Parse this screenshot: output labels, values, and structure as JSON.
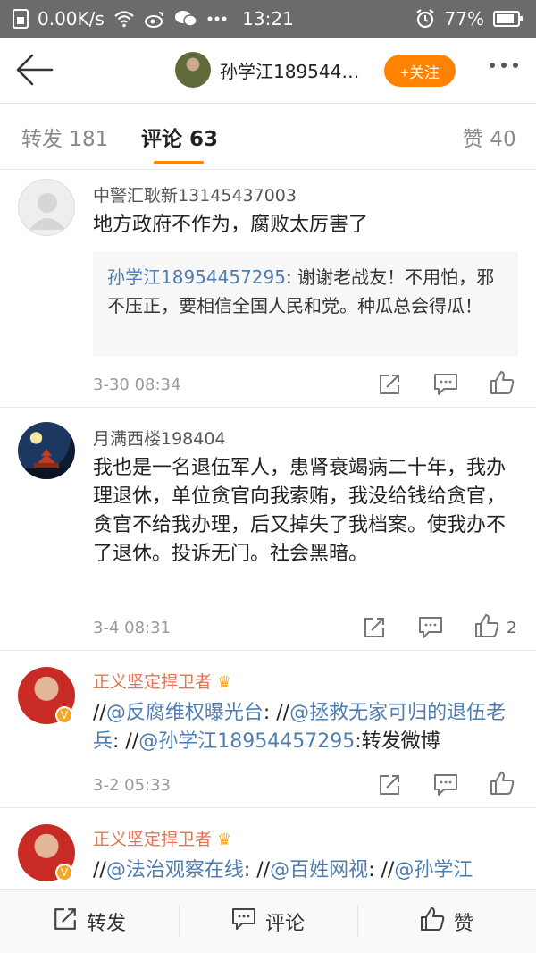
{
  "status": {
    "speed": "0.00K/s",
    "time": "13:21",
    "battery": "77%",
    "icons": [
      "sim-icon",
      "wifi-icon",
      "weibo-icon",
      "wechat-icon",
      "dots-icon",
      "alarm-icon",
      "battery-icon"
    ]
  },
  "nav": {
    "username": "孙学江189544…",
    "follow_label": "+关注"
  },
  "tabs": {
    "repost": "转发 181",
    "comment": "评论 63",
    "like": "赞 40"
  },
  "comments": [
    {
      "user": "中警汇耿新13145437003",
      "text": "地方政府不作为，腐败太厉害了",
      "reply_user": "孙学江18954457295",
      "reply_text": ": 谢谢老战友！不用怕，邪不压正，要相信全国人民和党。种瓜总会得瓜！",
      "time": "3-30 08:34",
      "likes": ""
    },
    {
      "user": "月满西楼198404",
      "text": "我也是一名退伍军人，患肾衰竭病二十年，我办理退休，单位贪官向我索贿，我没给钱给贪官，贪官不给我办理，后又掉失了我档案。使我办不了退休。投诉无门。社会黑暗。",
      "time": "3-4 08:31",
      "likes": "2"
    },
    {
      "user": "正义坚定捍卫者",
      "segments": [
        "//",
        "@反腐维权曝光台",
        ": //",
        "@拯救无家可归的退伍老兵",
        ": //",
        "@孙学江18954457295",
        ":转发微博"
      ],
      "time": "3-2 05:33",
      "likes": ""
    },
    {
      "user": "正义坚定捍卫者",
      "segments": [
        "//",
        "@法治观察在线",
        ": //",
        "@百姓网视",
        ": //",
        "@孙学江"
      ]
    }
  ],
  "bottom": {
    "repost": "转发",
    "comment": "评论",
    "like": "赞"
  },
  "colors": {
    "accent": "#ff8200",
    "link": "#507daf",
    "vip_name": "#eb7350"
  }
}
